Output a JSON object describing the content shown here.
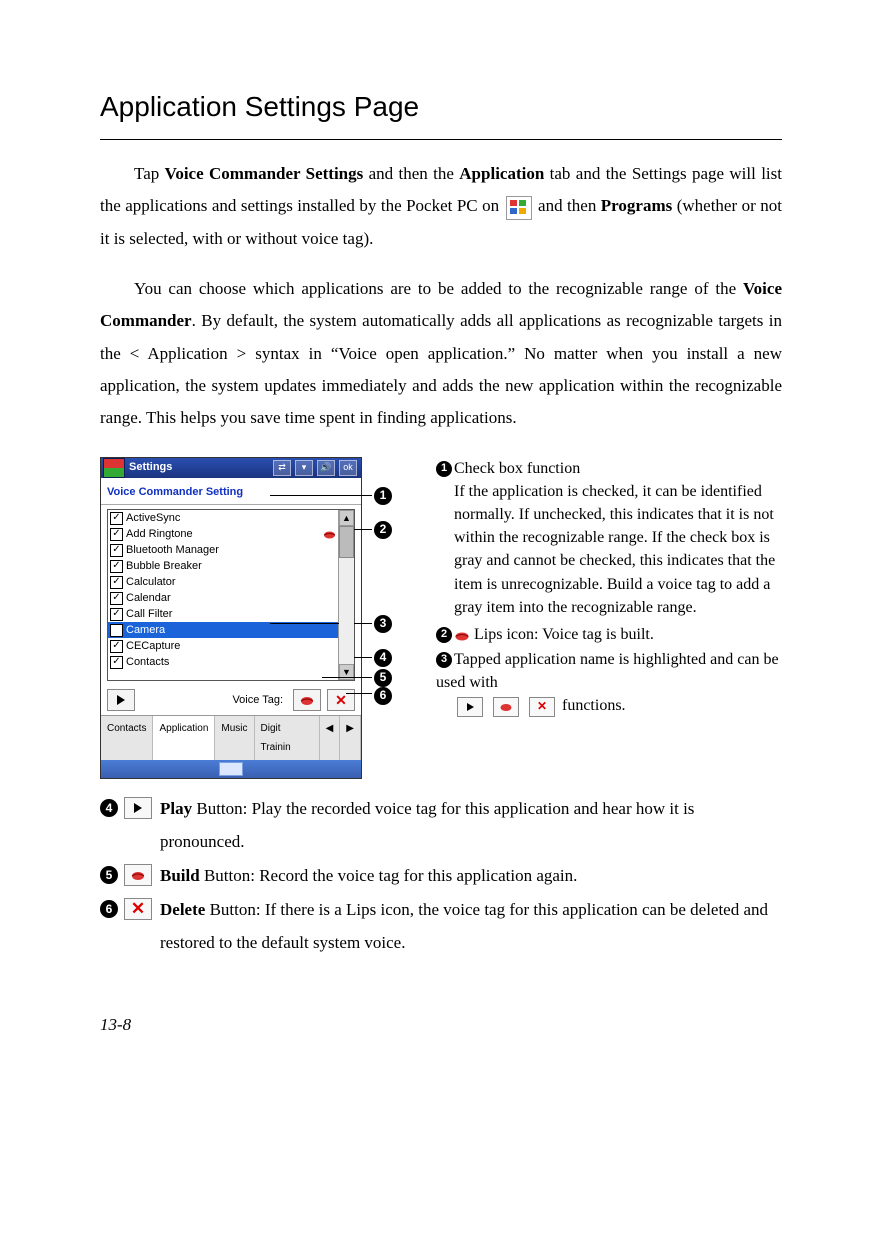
{
  "title": "Application Settings Page",
  "para1": {
    "t1": "Tap ",
    "b1": "Voice Commander Settings",
    "t2": " and then the ",
    "b2": "Application",
    "t3": " tab and the Settings page will list the applications and settings installed by the Pocket PC on ",
    "t4": " and then ",
    "b3": "Programs",
    "t5": " (whether or not it is selected, with or without voice tag)."
  },
  "para2": {
    "t1": "You can choose which applications are to be added to the recognizable range of the ",
    "b1": "Voice Commander",
    "t2": ". By default, the system automatically adds all applications as recognizable targets in the < Application > syntax in “Voice open application.” No matter when you install a new application, the system updates immediately and adds the new application within the recognizable range. This helps you save time spent in finding applications."
  },
  "device": {
    "title": "Settings",
    "ok": "ok",
    "subtitle": "Voice Commander Setting",
    "apps": [
      "ActiveSync",
      "Add Ringtone",
      "Bluetooth Manager",
      "Bubble Breaker",
      "Calculator",
      "Calendar",
      "Call Filter",
      "Camera",
      "CECapture",
      "Contacts"
    ],
    "selectedIndex": 7,
    "lipsIndex": 1,
    "voiceTagLabel": "Voice Tag:",
    "tabs": [
      "Contacts",
      "Application",
      "Music",
      "Digit Trainin"
    ],
    "tabSelected": 1
  },
  "callouts": {
    "c1": {
      "title": "Check box function",
      "body": "If the application is checked, it can be identified normally. If unchecked, this indicates that it is not within the recognizable range. If the check box is gray and cannot be checked, this indicates that the item is unrecognizable. Build a voice tag to add a gray item into the recognizable range."
    },
    "c2": " Lips icon: Voice tag is built.",
    "c3a": "Tapped application name is highlighted and can be used with",
    "c3b": " functions."
  },
  "anno": {
    "a4a": "Play",
    "a4b": " Button: Play the recorded voice tag for this application and hear how it is pronounced.",
    "a5a": "Build",
    "a5b": " Button: Record the voice tag for this application again.",
    "a6a": "Delete",
    "a6b": " Button: If there is a Lips icon, the voice tag for this application can be deleted and restored to the default system voice."
  },
  "pageNumber": "13-8"
}
